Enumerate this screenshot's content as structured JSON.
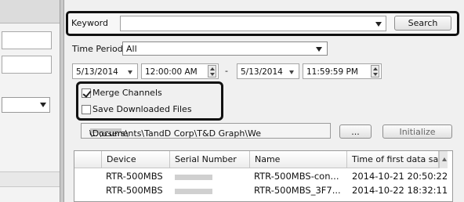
{
  "search": {
    "keyword_label": "Keyword",
    "keyword_value": "",
    "search_button": "Search"
  },
  "time_period": {
    "label": "Time Period",
    "selected": "All",
    "start_date": "5/13/2014",
    "start_time": "12:00:00 AM",
    "separator": "-",
    "end_date": "5/13/2014",
    "end_time": "11:59:59 PM"
  },
  "options": {
    "merge_channels": {
      "label": "Merge Channels",
      "checked": true
    },
    "save_downloaded": {
      "label": "Save Downloaded Files",
      "checked": false
    }
  },
  "path": {
    "prefix": "C:\\Users\\",
    "suffix": "\\Documents\\TandD Corp\\T&D Graph\\We",
    "browse_button": "...",
    "initialize_button": "Initialize"
  },
  "table": {
    "columns": [
      "Device",
      "Serial Number",
      "Name",
      "Time of first data sam..."
    ],
    "rows": [
      {
        "device": "RTR-500MBS",
        "name": "RTR-500MBS-con...",
        "time": "2014-10-21 20:50:22"
      },
      {
        "device": "RTR-500MBS",
        "name": "RTR-500MBS_3F7...",
        "time": "2014-10-22 18:32:11"
      }
    ]
  },
  "icons": {
    "dropdown": "chevron-down-icon",
    "spinner": "up-down-spinner-icon",
    "checkmark": "checkmark-icon"
  },
  "colors": {
    "highlight_border": "#111111",
    "panel_bg": "#f0f0f0"
  }
}
